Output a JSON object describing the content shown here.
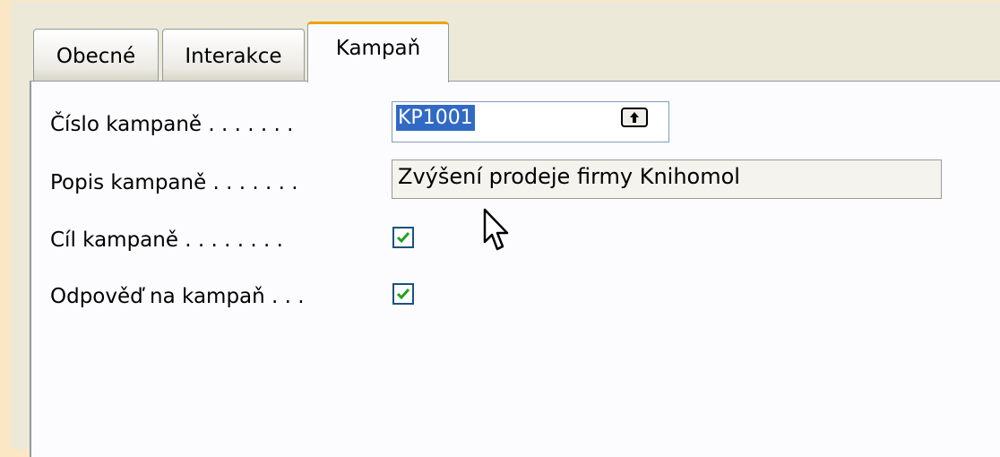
{
  "tabs": [
    {
      "label": "Obecné",
      "active": false
    },
    {
      "label": "Interakce",
      "active": false
    },
    {
      "label": "Kampaň",
      "active": true
    }
  ],
  "form": {
    "campaign_no": {
      "label": "Číslo kampaně . . . . . . .",
      "value": "KP1001",
      "selected": true
    },
    "campaign_desc": {
      "label": "Popis kampaně . . . . . . .",
      "value": "Zvýšení prodeje firmy Knihomol"
    },
    "campaign_target": {
      "label": "Cíl kampaně . . . . . . . .",
      "checked": true
    },
    "campaign_response": {
      "label": "Odpověď na kampaň . . .",
      "checked": true
    }
  },
  "colors": {
    "page_bg": "#fbe7c4",
    "active_tab_accent": "#f0a20c",
    "selection": "#316ac5",
    "check": "#21a121"
  },
  "icons": {
    "lookup": "arrow-up-icon",
    "checkbox": "checkmark-icon",
    "cursor": "mouse-pointer-icon"
  }
}
